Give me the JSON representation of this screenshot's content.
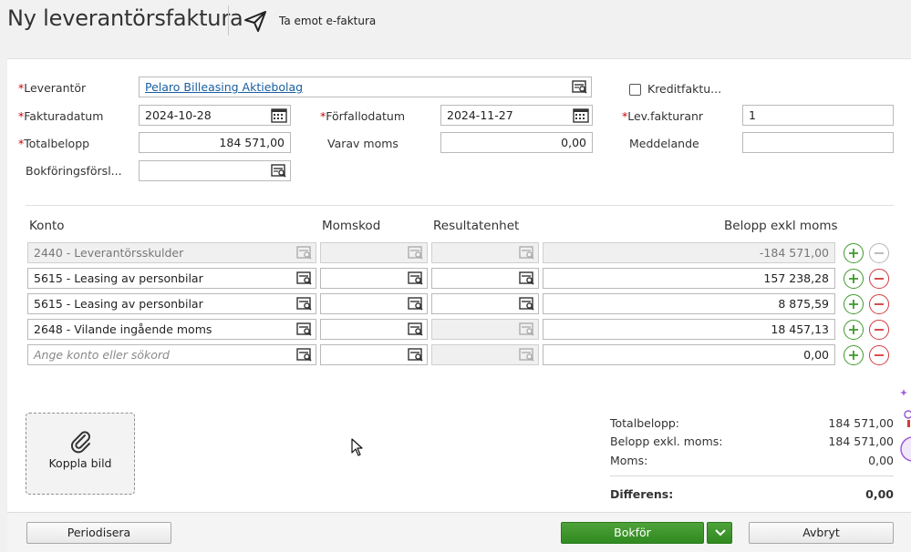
{
  "header": {
    "title": "Ny leverantörsfaktura",
    "efaktura_label": "Ta emot e-faktura"
  },
  "form": {
    "leverantor": {
      "label": "Leverantör",
      "value": "Pelaro Billeasing Aktiebolag"
    },
    "kreditfaktura": {
      "label": "Kreditfaktu...",
      "checked": false
    },
    "fakturadatum": {
      "label": "Fakturadatum",
      "value": "2024-10-28"
    },
    "forfallodatum": {
      "label": "Förfallodatum",
      "value": "2024-11-27"
    },
    "levfakturanr": {
      "label": "Lev.fakturanr",
      "value": "1"
    },
    "totalbelopp": {
      "label": "Totalbelopp",
      "value": "184 571,00"
    },
    "varav_moms": {
      "label": "Varav moms",
      "value": "0,00"
    },
    "meddelande": {
      "label": "Meddelande",
      "value": ""
    },
    "bokforingsforslag": {
      "label": "Bokföringsförsl...",
      "value": ""
    }
  },
  "table": {
    "headers": {
      "konto": "Konto",
      "momskod": "Momskod",
      "resultatenhet": "Resultatenhet",
      "belopp": "Belopp exkl moms"
    },
    "rows": [
      {
        "konto": "2440 - Leverantörsskulder",
        "momskod": "",
        "resultatenhet": "",
        "belopp": "-184 571,00"
      },
      {
        "konto": "5615 - Leasing av personbilar",
        "momskod": "",
        "resultatenhet": "",
        "belopp": "157 238,28"
      },
      {
        "konto": "5615 - Leasing av personbilar",
        "momskod": "",
        "resultatenhet": "",
        "belopp": "8 875,59"
      },
      {
        "konto": "2648 - Vilande ingående moms",
        "momskod": "",
        "resultatenhet": "",
        "belopp": "18 457,13"
      },
      {
        "konto_placeholder": "Ange konto eller sökord",
        "momskod": "",
        "resultatenhet": "",
        "belopp": "0,00"
      }
    ]
  },
  "attach": {
    "label": "Koppla bild"
  },
  "summary": {
    "totalbelopp": {
      "label": "Totalbelopp:",
      "value": "184 571,00"
    },
    "belopp_exkl": {
      "label": "Belopp exkl. moms:",
      "value": "184 571,00"
    },
    "moms": {
      "label": "Moms:",
      "value": "0,00"
    },
    "differens": {
      "label": "Differens:",
      "value": "0,00"
    }
  },
  "footer": {
    "periodisera": "Periodisera",
    "bokfor": "Bokför",
    "avbryt": "Avbryt"
  },
  "colors": {
    "accent_green": "#2f8a1f",
    "remove_red": "#d23b3b",
    "link_blue": "#1a5fa0",
    "required_red": "#cc0000"
  },
  "icons": [
    "send-icon",
    "search-list-icon",
    "calendar-icon",
    "plus-icon",
    "minus-icon",
    "paperclip-icon",
    "chevron-down-icon",
    "mouse-cursor-icon"
  ]
}
